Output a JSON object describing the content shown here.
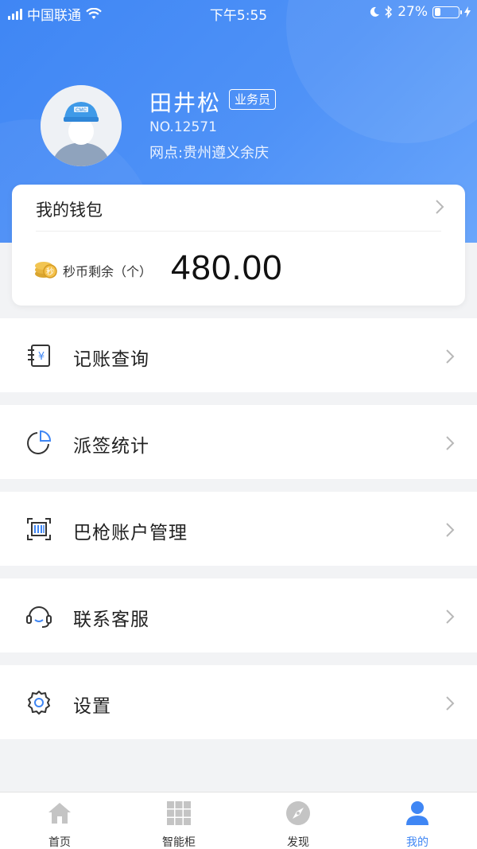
{
  "status_bar": {
    "carrier": "中国联通",
    "time": "下午5:55",
    "battery": "27%",
    "battery_level": 0.27
  },
  "profile": {
    "name": "田井松",
    "role": "业务员",
    "number": "NO.12571",
    "branch": "网点:贵州遵义余庆",
    "avatar_cap_text": "CMC"
  },
  "wallet": {
    "title": "我的钱包",
    "balance_label": "秒币剩余（个）",
    "balance": "480.00"
  },
  "menu": [
    {
      "label": "记账查询",
      "icon": "ledger-icon"
    },
    {
      "label": "派签统计",
      "icon": "pie-chart-icon"
    },
    {
      "label": "巴枪账户管理",
      "icon": "scanner-icon"
    },
    {
      "label": "联系客服",
      "icon": "headset-icon"
    },
    {
      "label": "设置",
      "icon": "gear-icon"
    }
  ],
  "tabbar": [
    {
      "label": "首页",
      "icon": "home-icon"
    },
    {
      "label": "智能柜",
      "icon": "locker-icon"
    },
    {
      "label": "发现",
      "icon": "compass-icon"
    },
    {
      "label": "我的",
      "icon": "person-icon",
      "active": true
    }
  ],
  "colors": {
    "accent": "#3f86f4",
    "hero_gradient_start": "#3f86f4",
    "hero_gradient_end": "#6aa6fb",
    "tab_inactive": "#c4c4c4"
  }
}
